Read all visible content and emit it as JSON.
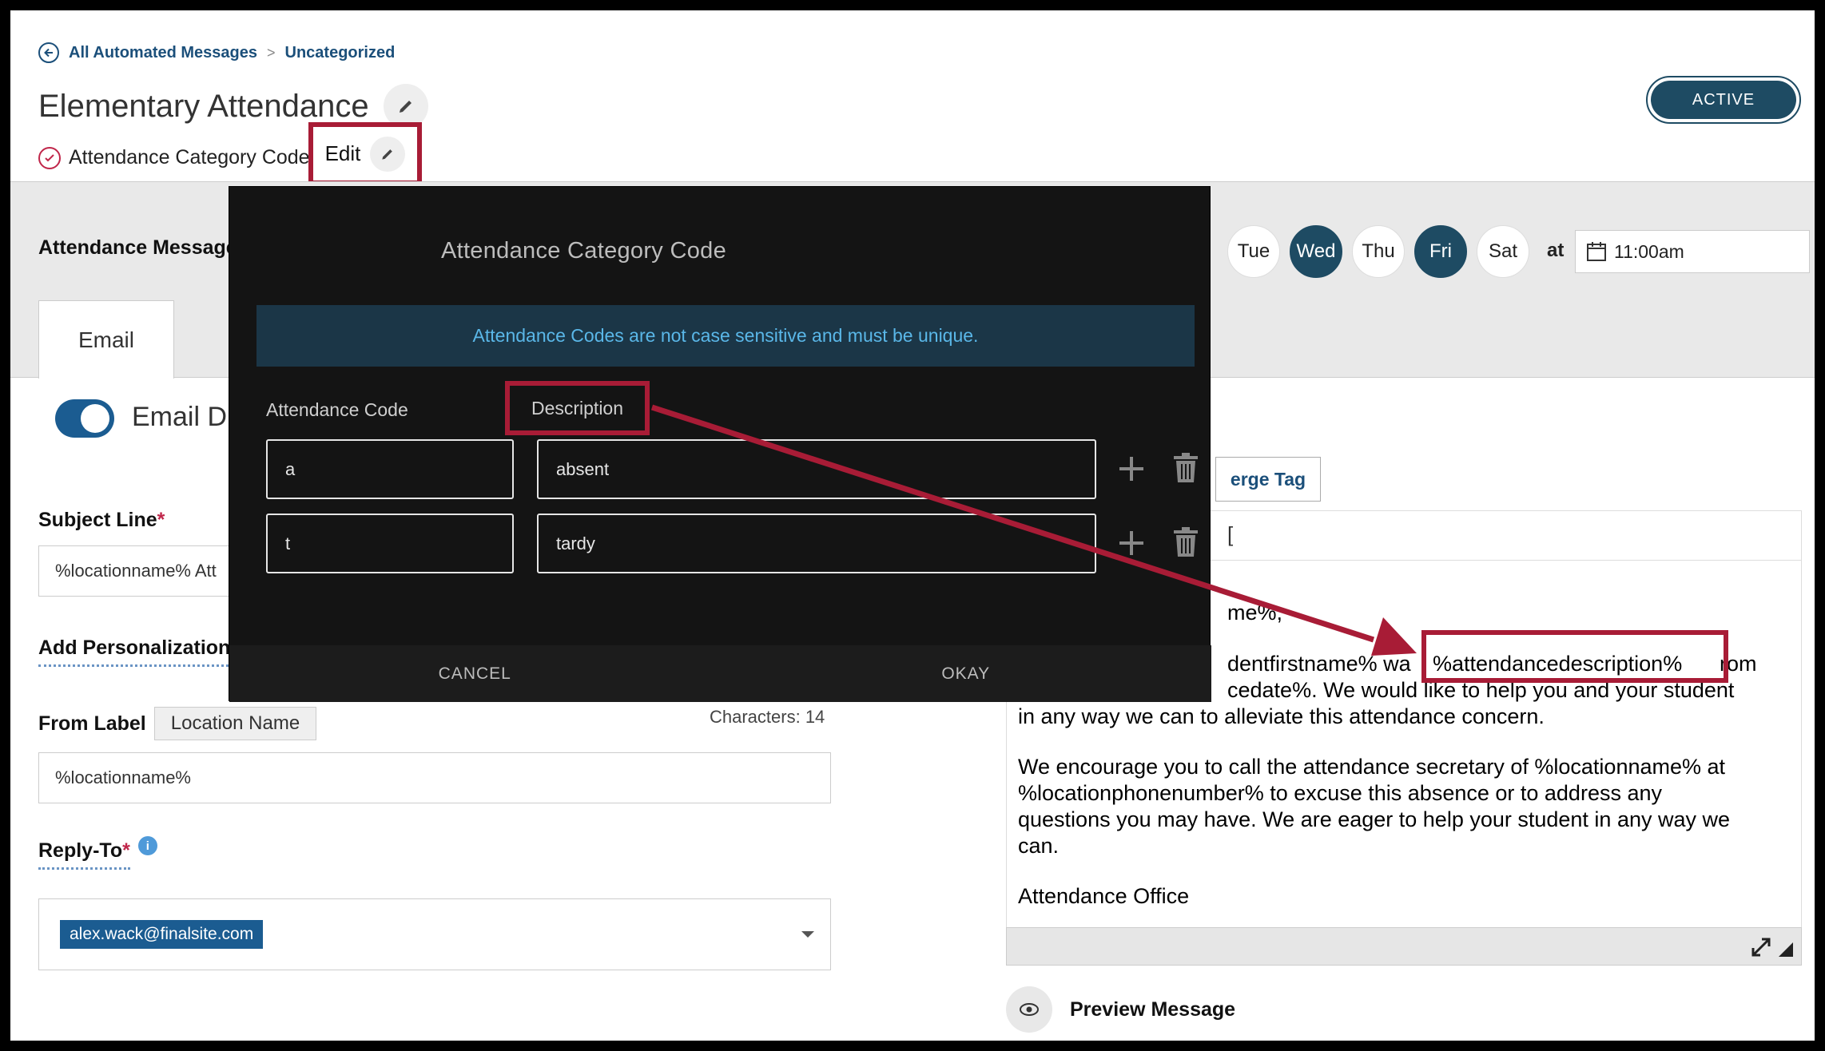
{
  "breadcrumb": {
    "root": "All Automated Messages",
    "separator": ">",
    "current": "Uncategorized"
  },
  "header": {
    "title": "Elementary Attendance",
    "category_label": "Attendance Category Code",
    "edit_label": "Edit",
    "status": "ACTIVE"
  },
  "schedule": {
    "label": "Attendance Message",
    "days": [
      {
        "label": "Tue",
        "selected": false
      },
      {
        "label": "Wed",
        "selected": true
      },
      {
        "label": "Thu",
        "selected": false
      },
      {
        "label": "Fri",
        "selected": true
      },
      {
        "label": "Sat",
        "selected": false
      }
    ],
    "at_label": "at",
    "time": "11:00am"
  },
  "tabs": {
    "email": "Email"
  },
  "form": {
    "email_toggle_label": "Email D",
    "subject_label": "Subject Line",
    "subject_value": "%locationname% Att",
    "add_personalization": "Add Personalization",
    "from_label": "From Label",
    "from_chip": "Location Name",
    "characters": "Characters: 14",
    "from_value": "%locationname%",
    "reply_to_label": "Reply-To",
    "reply_to_value": "alex.wack@finalsite.com"
  },
  "editor": {
    "merge_tag_label": "erge Tag",
    "toolbar_fragment": "[",
    "lines": [
      "me%,",
      "dentfirstname% wa",
      "%attendancedescription%",
      "rom",
      "cedate%.  We would like to help you and your student",
      "in any way we can to alleviate this attendance concern.",
      "We encourage you to call the attendance secretary of %locationname% at",
      "%locationphonenumber% to excuse this absence or to address any",
      "questions you may have.  We are eager to help your student in any way we",
      "can.",
      "Attendance Office"
    ],
    "preview_label": "Preview Message"
  },
  "modal": {
    "title": "Attendance Category Code",
    "notice": "Attendance Codes are not case sensitive and must be unique.",
    "col_code": "Attendance Code",
    "col_description": "Description",
    "rows": [
      {
        "code": "a",
        "description": "absent"
      },
      {
        "code": "t",
        "description": "tardy"
      }
    ],
    "cancel": "CANCEL",
    "okay": "OKAY"
  },
  "colors": {
    "accent": "#1e4b63",
    "highlight_red": "#a81c36",
    "link_blue": "#1b4f7a",
    "notice_bg": "#1b3647"
  },
  "icons": [
    "back-circle-icon",
    "pencil-icon",
    "check-circle-icon",
    "calendar-icon",
    "plus-icon",
    "trash-icon",
    "info-icon",
    "caret-down-icon",
    "expand-icon",
    "resize-icon",
    "eye-icon"
  ]
}
